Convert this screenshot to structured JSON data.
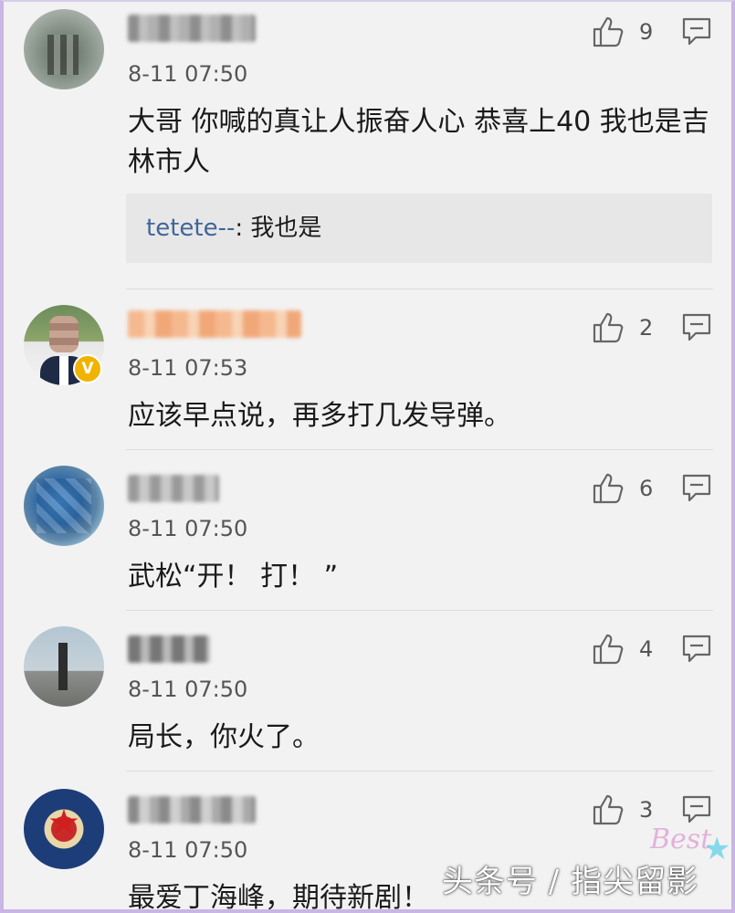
{
  "comments": [
    {
      "time": "8-11 07:50",
      "likes": "9",
      "text": "大哥 你喊的真让人振奋人心 恭喜上40 我也是吉林市人",
      "reply": {
        "user": "tetete--",
        "sep": ": ",
        "text": "我也是"
      }
    },
    {
      "time": "8-11 07:53",
      "likes": "2",
      "text": "应该早点说，再多打几发导弹。",
      "verified_badge": "V"
    },
    {
      "time": "8-11 07:50",
      "likes": "6",
      "text": "武松“开！ 打！ ”"
    },
    {
      "time": "8-11 07:50",
      "likes": "4",
      "text": "局长，你火了。"
    },
    {
      "time": "8-11 07:50",
      "likes": "3",
      "text": "最爱丁海峰，期待新剧！"
    }
  ],
  "watermark": "头条号 / 指尖留影",
  "corner_mark": "Best",
  "icons": {
    "like": "thumbs-up-icon",
    "reply": "comment-bubble-icon"
  },
  "colors": {
    "background": "#f2f2f2",
    "reply_user": "#406599",
    "frame": "#c9b6e4",
    "badge": "#f0b400"
  }
}
